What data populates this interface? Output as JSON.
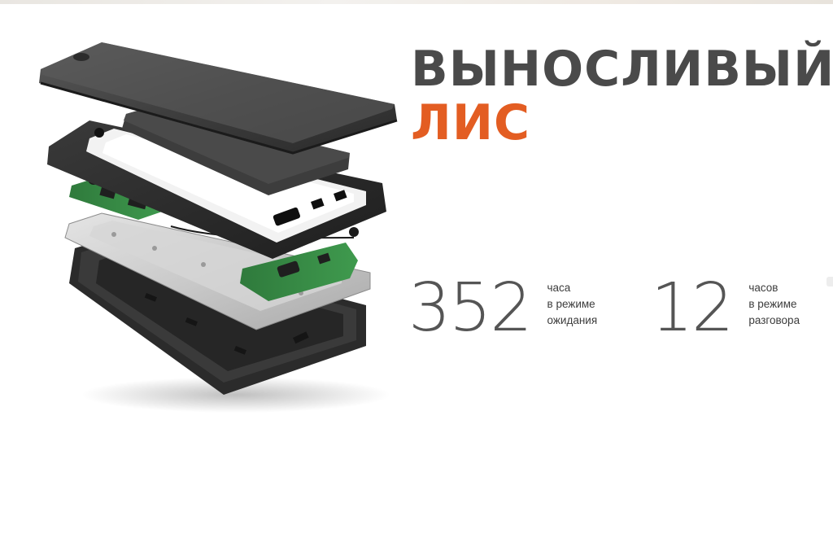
{
  "title": {
    "line1": "ВЫНОСЛИВЫЙ",
    "line2": "ЛИС"
  },
  "stats": [
    {
      "value": "352",
      "caption": [
        "часа",
        "в режиме",
        "ожидания"
      ]
    },
    {
      "value": "12",
      "caption": [
        "часов",
        "в режиме",
        "разговора"
      ]
    }
  ],
  "colors": {
    "title_dark": "#4a4a4a",
    "title_accent": "#e35d22",
    "number": "#555555"
  },
  "image": {
    "icon": "exploded-smartphone-illustration"
  }
}
